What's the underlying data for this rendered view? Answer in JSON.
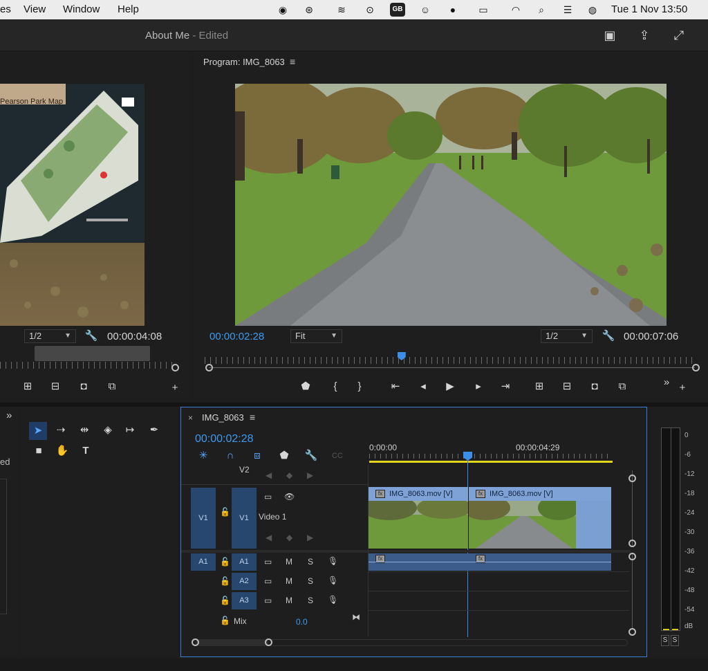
{
  "menubar": {
    "items": [
      "es",
      "View",
      "Window",
      "Help"
    ],
    "clock": "Tue 1 Nov  13:50",
    "status_icons": [
      "creative-cloud-icon",
      "cc-libraries-icon",
      "flow-icon",
      "play-circle-icon",
      "keyboard-gb-icon",
      "accessibility-icon",
      "shazam-icon",
      "battery-icon",
      "wifi-icon",
      "search-icon",
      "control-center-icon",
      "siri-icon"
    ],
    "gb_label": "GB"
  },
  "titlebar": {
    "title": "About Me",
    "edited": "- Edited"
  },
  "source": {
    "map_label": "Pearson Park Map",
    "resolution": "1/2",
    "timecode": "00:00:04:08",
    "controls": [
      "insert-icon",
      "overwrite-icon",
      "camera-icon",
      "export-frame-icon",
      "add-icon"
    ]
  },
  "program": {
    "title": "Program: IMG_8063",
    "timecode": "00:00:02:28",
    "fit": "Fit",
    "resolution": "1/2",
    "duration": "00:00:07:06",
    "playhead_fraction": 0.4,
    "controls": [
      "add-marker-icon",
      "mark-in-icon",
      "mark-out-icon",
      "go-to-in-icon",
      "step-back-icon",
      "play-icon",
      "step-forward-icon",
      "go-to-out-icon",
      "lift-icon",
      "extract-icon",
      "export-frame-icon",
      "comparison-icon",
      "more-icon",
      "add-icon"
    ]
  },
  "tools": {
    "collapse": "»",
    "side_text": "ed"
  },
  "timeline": {
    "tab": "IMG_8063",
    "timecode": "00:00:02:28",
    "ruler": [
      "0:00:00",
      "00:00:04:29"
    ],
    "tracks": {
      "v2": "V2",
      "v1_src": "V1",
      "v1": "V1",
      "v1_name": "Video 1",
      "a1_src": "A1",
      "a1": "A1",
      "a2": "A2",
      "a3": "A3",
      "m": "M",
      "s": "S",
      "mix": "Mix",
      "mix_value": "0.0"
    },
    "clips": [
      "IMG_8063.mov [V]",
      "IMG_8063.mov [V]"
    ]
  },
  "meter": {
    "labels": [
      "0",
      "-6",
      "-12",
      "-18",
      "-24",
      "-30",
      "-36",
      "-42",
      "-48",
      "-54",
      "dB"
    ],
    "solo": [
      "S",
      "S"
    ]
  }
}
